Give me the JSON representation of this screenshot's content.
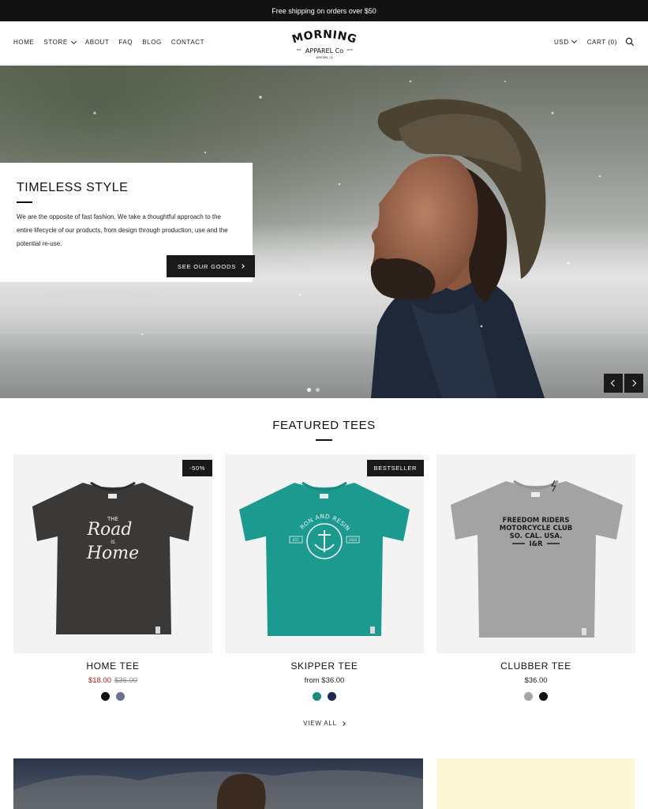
{
  "announcement": "Free shipping on orders over $50",
  "nav": {
    "items": [
      "HOME",
      "STORE",
      "ABOUT",
      "FAQ",
      "BLOG",
      "CONTACT"
    ],
    "currency": "USD",
    "cart": "CART (0)"
  },
  "logo": {
    "line1": "MORNING",
    "line2": "APPAREL Co",
    "est": "EST.",
    "year": "2016",
    "location": "VENTURA, CA"
  },
  "hero": {
    "title": "TIMELESS STYLE",
    "text": "We are the opposite of fast fashion. We take a thoughtful approach to the entire lifecycle of our products, from design through production, use and the potential re-use.",
    "cta": "SEE OUR GOODS"
  },
  "featured": {
    "title": "FEATURED TEES",
    "view_all": "VIEW ALL",
    "products": [
      {
        "name": "HOME TEE",
        "price": "$18.00",
        "compare_price": "$36.00",
        "badge": "-50%",
        "shirt_color": "#3a3937",
        "swatches": [
          "#111111",
          "#6a6f8e"
        ],
        "print": {
          "small": "THE",
          "script1": "Road",
          "mid": "IS",
          "script2": "Home"
        }
      },
      {
        "name": "SKIPPER TEE",
        "price": "from $36.00",
        "badge": "BESTSELLER",
        "shirt_color": "#1d9a90",
        "swatches": [
          "#1c8a83",
          "#1b2754"
        ],
        "print": {
          "arc": "IRON AND RESIN",
          "side_left": "EST.",
          "side_right": "2010"
        }
      },
      {
        "name": "CLUBBER TEE",
        "price": "$36.00",
        "shirt_color": "#a3a3a3",
        "swatches": [
          "#a5a5a5",
          "#111111"
        ],
        "print": {
          "line1": "FREEDOM RIDERS",
          "line2": "MOTORCYCLE CLUB",
          "line3": "SO. CAL. USA.",
          "line4": "I&R"
        }
      }
    ]
  }
}
